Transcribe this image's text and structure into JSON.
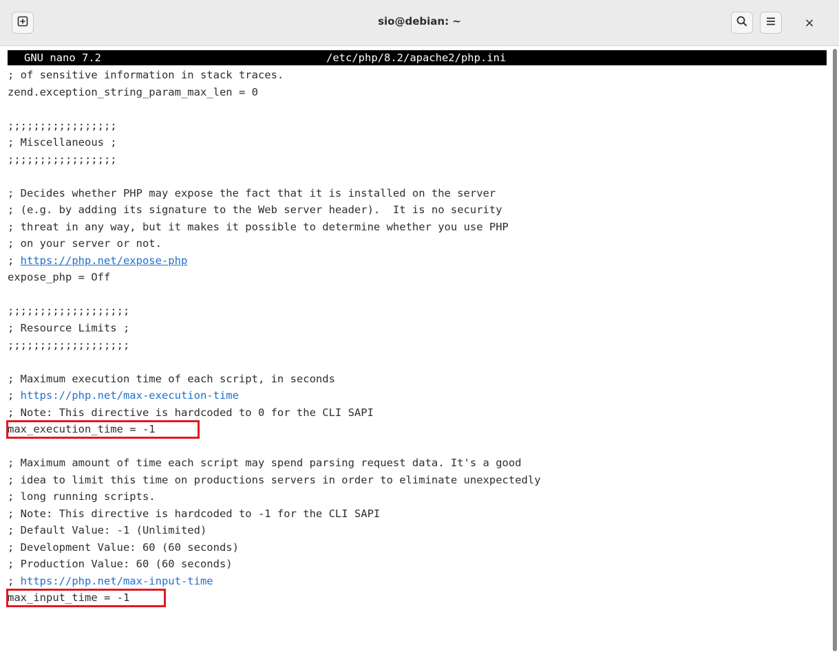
{
  "window": {
    "title": "sio@debian: ~",
    "close_glyph": "×"
  },
  "icons": {
    "new_tab": "new-tab-icon",
    "search": "search-icon",
    "menu": "hamburger-menu-icon",
    "close": "close-icon"
  },
  "nano": {
    "app_version": "GNU nano 7.2",
    "file_path": "/etc/php/8.2/apache2/php.ini"
  },
  "lines": [
    {
      "text": "; of sensitive information in stack traces."
    },
    {
      "text": "zend.exception_string_param_max_len = 0"
    },
    {
      "text": ""
    },
    {
      "text": ";;;;;;;;;;;;;;;;;"
    },
    {
      "text": "; Miscellaneous ;"
    },
    {
      "text": ";;;;;;;;;;;;;;;;;"
    },
    {
      "text": ""
    },
    {
      "text": "; Decides whether PHP may expose the fact that it is installed on the server"
    },
    {
      "text": "; (e.g. by adding its signature to the Web server header).  It is no security"
    },
    {
      "text": "; threat in any way, but it makes it possible to determine whether you use PHP"
    },
    {
      "text": "; on your server or not."
    },
    {
      "prefix": "; ",
      "link": "https://php.net/expose-php",
      "underline": true
    },
    {
      "text": "expose_php = Off"
    },
    {
      "text": ""
    },
    {
      "text": ";;;;;;;;;;;;;;;;;;;"
    },
    {
      "text": "; Resource Limits ;"
    },
    {
      "text": ";;;;;;;;;;;;;;;;;;;"
    },
    {
      "text": ""
    },
    {
      "text": "; Maximum execution time of each script, in seconds"
    },
    {
      "prefix": "; ",
      "link": "https://php.net/max-execution-time",
      "underline": false
    },
    {
      "text": "; Note: This directive is hardcoded to 0 for the CLI SAPI"
    },
    {
      "text": "max_execution_time = -1",
      "highlight": true
    },
    {
      "text": ""
    },
    {
      "text": "; Maximum amount of time each script may spend parsing request data. It's a good"
    },
    {
      "text": "; idea to limit this time on productions servers in order to eliminate unexpectedly"
    },
    {
      "text": "; long running scripts."
    },
    {
      "text": "; Note: This directive is hardcoded to -1 for the CLI SAPI"
    },
    {
      "text": "; Default Value: -1 (Unlimited)"
    },
    {
      "text": "; Development Value: 60 (60 seconds)"
    },
    {
      "text": "; Production Value: 60 (60 seconds)"
    },
    {
      "prefix": "; ",
      "link": "https://php.net/max-input-time",
      "underline": false
    },
    {
      "text": "max_input_time = -1",
      "highlight": true
    }
  ],
  "colors": {
    "link": "#1f6fcf",
    "highlight_border": "#e0191f",
    "nano_titlebar_bg": "#000000",
    "text": "#2e2e2e"
  }
}
